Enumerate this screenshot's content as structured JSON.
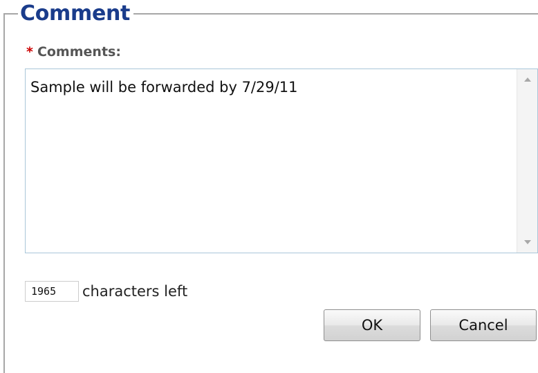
{
  "dialog": {
    "legend": "Comment"
  },
  "comments": {
    "required_marker": "*",
    "label": "Comments:",
    "value": "Sample will be forwarded by 7/29/11"
  },
  "counter": {
    "value": "1965",
    "label": "characters left"
  },
  "buttons": {
    "ok_label": "OK",
    "cancel_label": "Cancel"
  },
  "colors": {
    "legend_text": "#1a3c8b",
    "required_marker": "#cc0000",
    "textarea_border": "#a9c6d9"
  },
  "icons": {
    "scroll_up": "scroll-up-arrow-icon",
    "scroll_down": "scroll-down-arrow-icon"
  }
}
